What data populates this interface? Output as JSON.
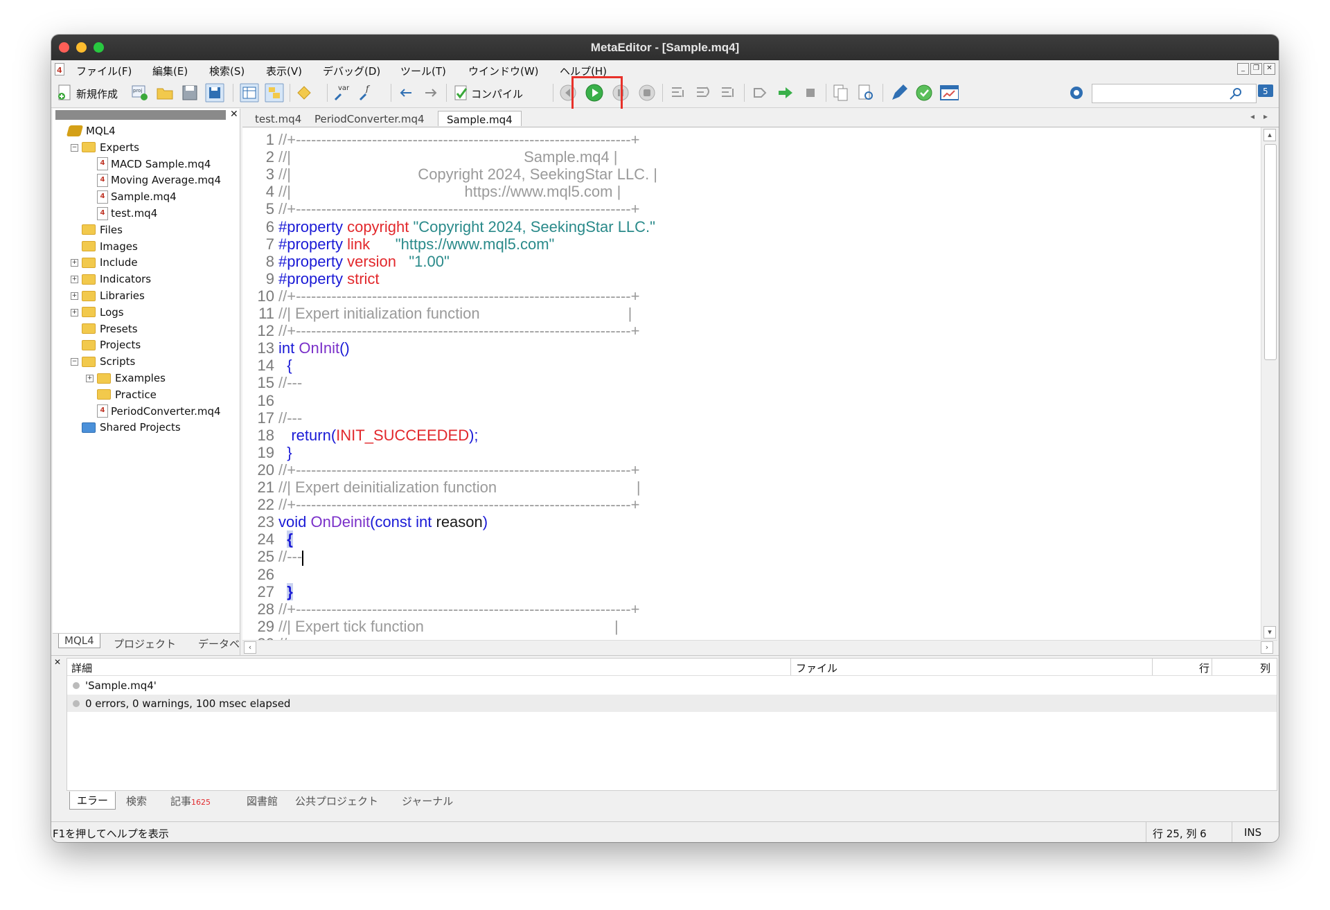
{
  "window": {
    "title": "MetaEditor - [Sample.mq4]"
  },
  "menu": [
    "ファイル(F)",
    "編集(E)",
    "検索(S)",
    "表示(V)",
    "デバッグ(D)",
    "ツール(T)",
    "ウインドウ(W)",
    "ヘルプ(H)"
  ],
  "toolbar": {
    "new_label": "新規作成",
    "compile_label": "コンパイル",
    "var_label": "var"
  },
  "navigator": {
    "tree": [
      {
        "label": "MQL4",
        "icon": "mql4-icon",
        "level": 0,
        "type": "root"
      },
      {
        "label": "Experts",
        "icon": "folder-icon",
        "level": 1,
        "type": "folder",
        "expand": "minus"
      },
      {
        "label": "MACD Sample.mq4",
        "icon": "mq4-file-icon",
        "level": 2,
        "type": "file"
      },
      {
        "label": "Moving Average.mq4",
        "icon": "mq4-file-icon",
        "level": 2,
        "type": "file"
      },
      {
        "label": "Sample.mq4",
        "icon": "mq4-file-icon",
        "level": 2,
        "type": "file"
      },
      {
        "label": "test.mq4",
        "icon": "mq4-file-icon",
        "level": 2,
        "type": "file"
      },
      {
        "label": "Files",
        "icon": "folder-icon",
        "level": 1,
        "type": "folder"
      },
      {
        "label": "Images",
        "icon": "folder-icon",
        "level": 1,
        "type": "folder"
      },
      {
        "label": "Include",
        "icon": "folder-icon",
        "level": 1,
        "type": "folder",
        "expand": "plus"
      },
      {
        "label": "Indicators",
        "icon": "folder-icon",
        "level": 1,
        "type": "folder",
        "expand": "plus"
      },
      {
        "label": "Libraries",
        "icon": "folder-icon",
        "level": 1,
        "type": "folder",
        "expand": "plus"
      },
      {
        "label": "Logs",
        "icon": "folder-icon",
        "level": 1,
        "type": "folder",
        "expand": "plus"
      },
      {
        "label": "Presets",
        "icon": "folder-icon",
        "level": 1,
        "type": "folder"
      },
      {
        "label": "Projects",
        "icon": "folder-icon",
        "level": 1,
        "type": "folder"
      },
      {
        "label": "Scripts",
        "icon": "folder-icon",
        "level": 1,
        "type": "folder",
        "expand": "minus"
      },
      {
        "label": "Examples",
        "icon": "folder-icon",
        "level": 2,
        "type": "folder",
        "expand": "plus"
      },
      {
        "label": "Practice",
        "icon": "folder-icon",
        "level": 2,
        "type": "folder"
      },
      {
        "label": "PeriodConverter.mq4",
        "icon": "mq4-file-icon",
        "level": 2,
        "type": "file"
      },
      {
        "label": "Shared Projects",
        "icon": "shared-folder-icon",
        "level": 1,
        "type": "folder-blue"
      }
    ],
    "tabs": [
      "MQL4",
      "プロジェクト",
      "データベ"
    ]
  },
  "doc_tabs": [
    "test.mq4",
    "PeriodConverter.mq4",
    "Sample.mq4"
  ],
  "active_doc": "Sample.mq4",
  "code": [
    {
      "n": "1",
      "parts": [
        [
          "c",
          "//+------------------------------------------------------------------+"
        ]
      ]
    },
    {
      "n": "2",
      "parts": [
        [
          "c",
          "//|                                                       Sample.mq4 |"
        ]
      ]
    },
    {
      "n": "3",
      "parts": [
        [
          "c",
          "//|                              Copyright 2024, SeekingStar LLC. |"
        ]
      ]
    },
    {
      "n": "4",
      "parts": [
        [
          "c",
          "//|                                         https://www.mql5.com |"
        ]
      ]
    },
    {
      "n": "5",
      "parts": [
        [
          "c",
          "//+------------------------------------------------------------------+"
        ]
      ]
    },
    {
      "n": "6",
      "parts": [
        [
          "k",
          "#property"
        ],
        [
          "i",
          " "
        ],
        [
          "p",
          "copyright"
        ],
        [
          "i",
          " "
        ],
        [
          "s",
          "\"Copyright 2024, SeekingStar LLC.\""
        ]
      ]
    },
    {
      "n": "7",
      "parts": [
        [
          "k",
          "#property"
        ],
        [
          "i",
          " "
        ],
        [
          "p",
          "link"
        ],
        [
          "i",
          "      "
        ],
        [
          "s",
          "\"https://www.mql5.com\""
        ]
      ]
    },
    {
      "n": "8",
      "parts": [
        [
          "k",
          "#property"
        ],
        [
          "i",
          " "
        ],
        [
          "p",
          "version"
        ],
        [
          "i",
          "   "
        ],
        [
          "s",
          "\"1.00\""
        ]
      ]
    },
    {
      "n": "9",
      "parts": [
        [
          "k",
          "#property"
        ],
        [
          "i",
          " "
        ],
        [
          "p",
          "strict"
        ]
      ]
    },
    {
      "n": "10",
      "parts": [
        [
          "c",
          "//+------------------------------------------------------------------+"
        ]
      ]
    },
    {
      "n": "11",
      "parts": [
        [
          "c",
          "//| Expert initialization function                                   |"
        ]
      ]
    },
    {
      "n": "12",
      "parts": [
        [
          "c",
          "//+------------------------------------------------------------------+"
        ]
      ]
    },
    {
      "n": "13",
      "parts": [
        [
          "k",
          "int"
        ],
        [
          "i",
          " "
        ],
        [
          "f",
          "OnInit"
        ],
        [
          "k",
          "()"
        ]
      ]
    },
    {
      "n": "14",
      "parts": [
        [
          "i",
          "  "
        ],
        [
          "k",
          "{"
        ]
      ]
    },
    {
      "n": "15",
      "parts": [
        [
          "c",
          "//---"
        ]
      ]
    },
    {
      "n": "16",
      "parts": []
    },
    {
      "n": "17",
      "parts": [
        [
          "c",
          "//---"
        ]
      ]
    },
    {
      "n": "18",
      "parts": [
        [
          "i",
          "   "
        ],
        [
          "k",
          "return"
        ],
        [
          "k",
          "("
        ],
        [
          "x",
          "INIT_SUCCEEDED"
        ],
        [
          "k",
          ");"
        ]
      ]
    },
    {
      "n": "19",
      "parts": [
        [
          "i",
          "  "
        ],
        [
          "k",
          "}"
        ]
      ]
    },
    {
      "n": "20",
      "parts": [
        [
          "c",
          "//+------------------------------------------------------------------+"
        ]
      ]
    },
    {
      "n": "21",
      "parts": [
        [
          "c",
          "//| Expert deinitialization function                                 |"
        ]
      ]
    },
    {
      "n": "22",
      "parts": [
        [
          "c",
          "//+------------------------------------------------------------------+"
        ]
      ]
    },
    {
      "n": "23",
      "parts": [
        [
          "k",
          "void"
        ],
        [
          "i",
          " "
        ],
        [
          "f",
          "OnDeinit"
        ],
        [
          "k",
          "("
        ],
        [
          "k",
          "const"
        ],
        [
          "i",
          " "
        ],
        [
          "k",
          "int"
        ],
        [
          "i",
          " reason"
        ],
        [
          "k",
          ")"
        ]
      ]
    },
    {
      "n": "24",
      "parts": [
        [
          "i",
          "  "
        ],
        [
          "b",
          "{"
        ]
      ]
    },
    {
      "n": "25",
      "parts": [
        [
          "c",
          "//---"
        ],
        [
          "caret",
          ""
        ]
      ]
    },
    {
      "n": "26",
      "parts": []
    },
    {
      "n": "27",
      "parts": [
        [
          "i",
          "  "
        ],
        [
          "b",
          "}"
        ]
      ]
    },
    {
      "n": "28",
      "parts": [
        [
          "c",
          "//+------------------------------------------------------------------+"
        ]
      ]
    },
    {
      "n": "29",
      "parts": [
        [
          "c",
          "//| Expert tick function                                             |"
        ]
      ]
    },
    {
      "n": "30",
      "parts": [
        [
          "c",
          "//+------------------------------------------------------------------+"
        ]
      ]
    }
  ],
  "toolbox": {
    "columns": {
      "detail": "詳細",
      "file": "ファイル",
      "line": "行",
      "col": "列"
    },
    "messages": [
      "'Sample.mq4'",
      "0 errors, 0 warnings, 100 msec elapsed"
    ],
    "tabs": [
      "エラー",
      "検索",
      "記事",
      "図書館",
      "公共プロジェクト",
      "ジャーナル"
    ],
    "article_badge": "1625"
  },
  "status": {
    "help": "F1を押してヘルプを表示",
    "position": "行 25, 列 6",
    "mode": "INS"
  },
  "colors": {
    "highlight_box": "#e8312a",
    "keyword": "#1a1ad6",
    "property": "#e2282c",
    "string": "#2a8a8a",
    "function": "#7a30c9",
    "comment": "#9a9a9a"
  }
}
